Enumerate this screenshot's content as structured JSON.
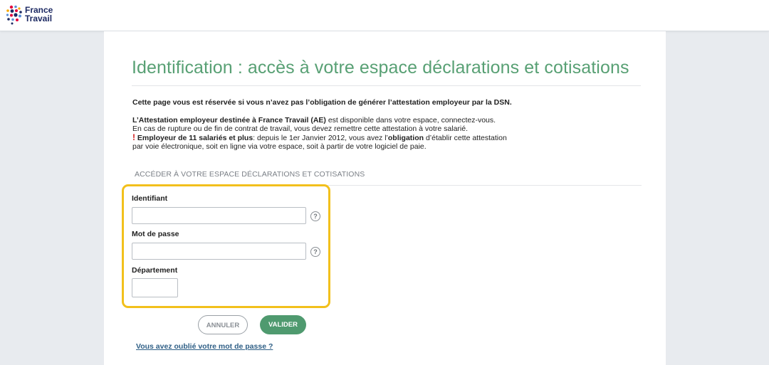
{
  "brand": {
    "line1": "France",
    "line2": "Travail"
  },
  "page": {
    "title": "Identification : accès à votre espace déclarations et cotisations"
  },
  "intro": {
    "lead": "Cette page vous est réservée si vous n’avez pas l’obligation de générer l’attestation employeur par la DSN.",
    "ae_bold": "L’Attestation employeur destinée à France Travail (AE)",
    "ae_rest": " est disponible dans votre espace, connectez-vous.",
    "rupture": "En cas de rupture ou de fin de contrat de travail, vous devez remettre cette attestation à votre salarié.",
    "warn_mark": "!",
    "employer_bold": " Employeur de 11 salariés et plus",
    "employer_mid": ": depuis le 1er Janvier 2012, vous avez l’",
    "obligation_bold": "obligation",
    "employer_end": " d’établir cette attestation",
    "employer_line2": "par voie électronique, soit en ligne via votre espace, soit à partir de votre logiciel de paie."
  },
  "section": {
    "label": "ACCÉDER À VOTRE ESPACE DÉCLARATIONS ET COTISATIONS"
  },
  "form": {
    "identifiant_label": "Identifiant",
    "identifiant_value": "",
    "password_label": "Mot de passe",
    "password_value": "",
    "departement_label": "Département",
    "departement_value": "",
    "help_glyph": "?"
  },
  "actions": {
    "cancel_label": "ANNULER",
    "submit_label": "VALIDER",
    "forgot_link": "Vous avez oublié votre mot de passe ?"
  },
  "colors": {
    "title_green": "#58a074",
    "button_green": "#4f9a6f",
    "highlight_yellow": "#f2c01c",
    "link_blue": "#2f5f86",
    "warn_red": "#d11a1a"
  },
  "icons": {
    "logo": "france-travail-dots-logo",
    "help": "question-circle-icon"
  }
}
